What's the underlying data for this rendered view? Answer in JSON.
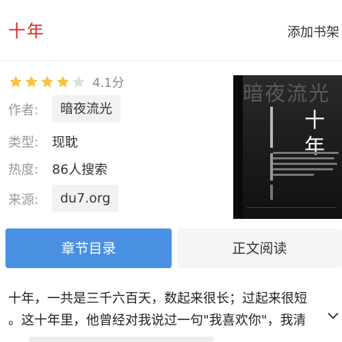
{
  "header": {
    "title": "十年",
    "add_shelf_label": "添加书架"
  },
  "rating": {
    "stars_filled": 4,
    "stars_total": 5,
    "text": "4.1分"
  },
  "info": {
    "author": {
      "label": "作者:",
      "value": "暗夜流光"
    },
    "genre": {
      "label": "类型:",
      "value": "现耽"
    },
    "popularity": {
      "label": "热度:",
      "value": "86人搜索"
    },
    "source": {
      "label": "来源:",
      "value": "du7.org"
    }
  },
  "cover": {
    "big_text": "暗夜流光",
    "title": "十年"
  },
  "actions": {
    "toc_label": "章节目录",
    "read_label": "正文阅读"
  },
  "summary": {
    "line1": "十年，一共是三千六百天，数起来很长；过起来很短",
    "line2": "。这十年里，他曾经对我说过一句\"我喜欢你\"，我清"
  },
  "colors": {
    "title_red": "#e02424",
    "accent_blue": "#4a90e2",
    "star": "#f6c342"
  }
}
